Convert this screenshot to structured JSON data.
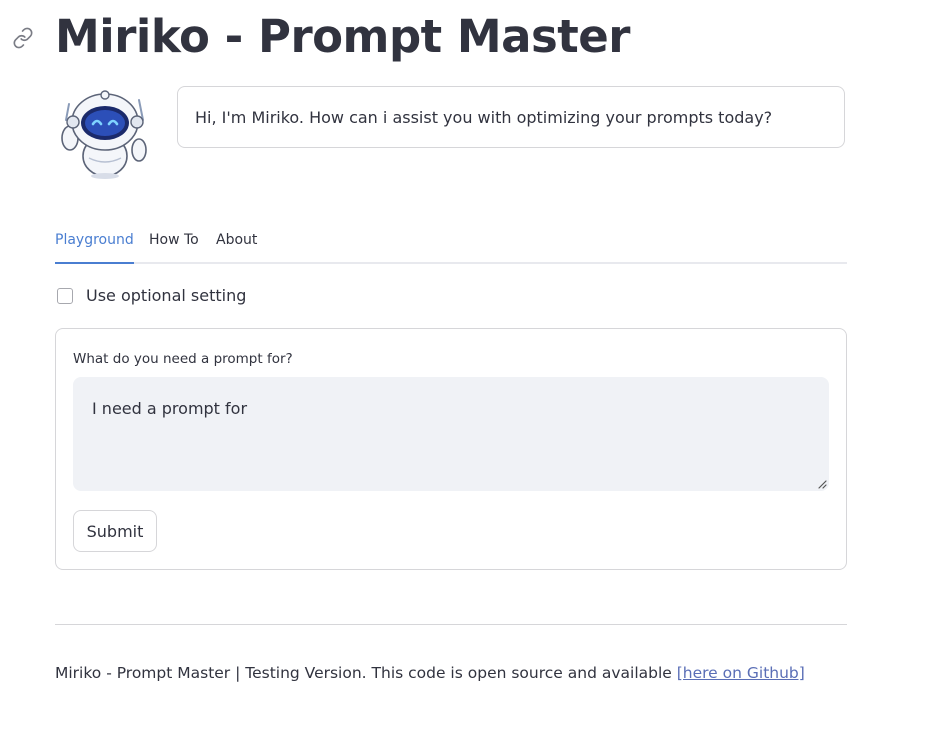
{
  "header": {
    "title": "Miriko - Prompt Master",
    "anchor_icon": "link-icon"
  },
  "assistant": {
    "avatar_icon": "robot-avatar",
    "greeting": "Hi, I'm Miriko. How can i assist you with optimizing your prompts today?"
  },
  "tabs": [
    {
      "label": "Playground",
      "active": true
    },
    {
      "label": "How To",
      "active": false
    },
    {
      "label": "About",
      "active": false
    }
  ],
  "settings": {
    "optional_label": "Use optional setting",
    "optional_checked": false
  },
  "form": {
    "field_label": "What do you need a prompt for?",
    "field_value": "I need a prompt for",
    "submit_label": "Submit"
  },
  "footer": {
    "text": "Miriko - Prompt Master | Testing Version. This code is open source and available ",
    "link_text": "[here on Github]"
  },
  "colors": {
    "accent": "#4a7ed1",
    "text": "#31333f",
    "field_bg": "#f0f2f6",
    "link": "#5a6eb6"
  }
}
